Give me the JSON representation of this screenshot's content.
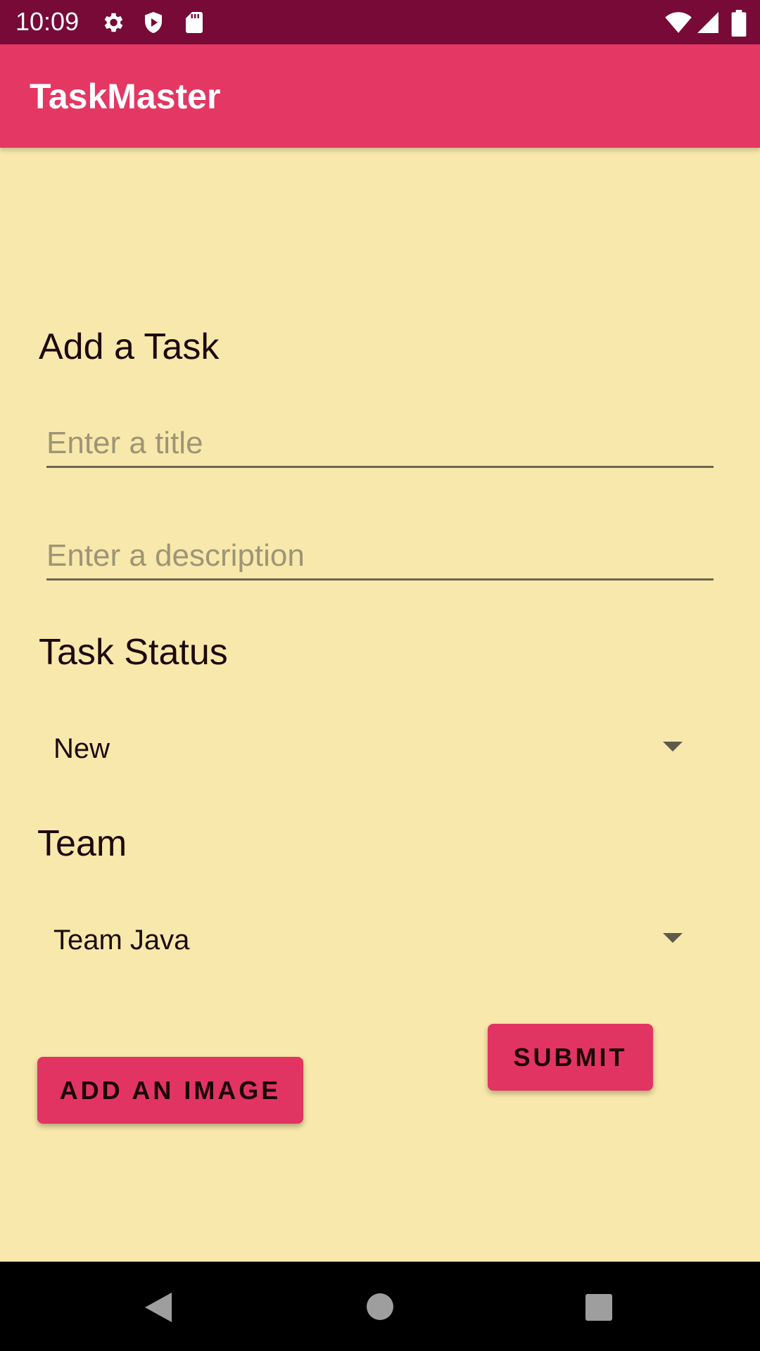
{
  "status_bar": {
    "time": "10:09",
    "icons": [
      "gear-icon",
      "shield-icon",
      "sd-card-icon",
      "wifi-icon",
      "signal-icon",
      "battery-icon"
    ]
  },
  "app_bar": {
    "title": "TaskMaster"
  },
  "form": {
    "heading": "Add a Task",
    "title_placeholder": "Enter a title",
    "title_value": "",
    "description_placeholder": "Enter a description",
    "description_value": ""
  },
  "task_status": {
    "label": "Task Status",
    "selected": "New"
  },
  "team": {
    "label": "Team",
    "selected": "Team Java"
  },
  "buttons": {
    "submit_label": "SUBMIT",
    "add_image_label": "ADD AN IMAGE"
  },
  "nav_bar": {
    "icons": [
      "back-icon",
      "home-icon",
      "recents-icon"
    ]
  },
  "colors": {
    "status_bar": "#770a36",
    "app_bar": "#e43763",
    "background": "#f8e8ab",
    "button": "#e23462"
  }
}
